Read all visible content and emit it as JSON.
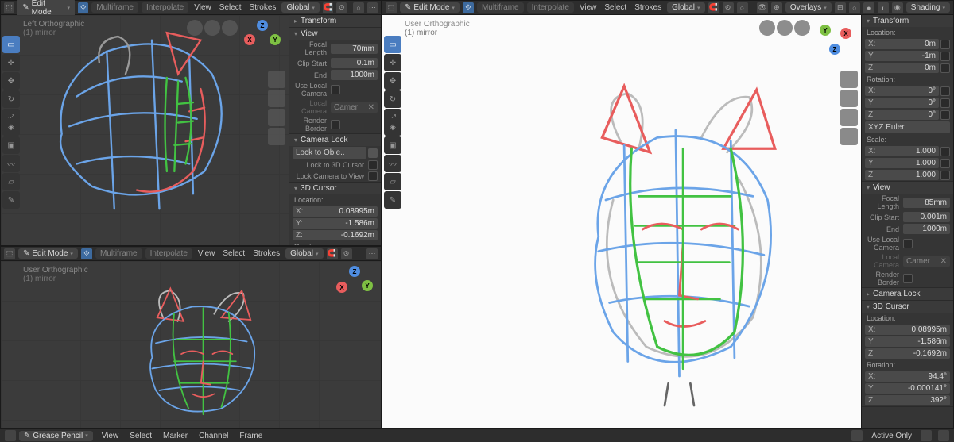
{
  "header": {
    "mode": "Edit Mode",
    "multiframe": "Multiframe",
    "interpolate": "Interpolate",
    "menus": [
      "View",
      "Select",
      "Strokes"
    ],
    "orientation": "Global",
    "overlays": "Overlays",
    "shading": "Shading"
  },
  "viewports": {
    "top_left": {
      "title": "Left Orthographic",
      "collection": "(1) mirror"
    },
    "bottom_left": {
      "title": "User Orthographic",
      "collection": "(1) mirror"
    },
    "right": {
      "title": "User Orthographic",
      "collection": "(1) mirror"
    }
  },
  "npanel": {
    "transform": "Transform",
    "view": "View",
    "focal_label": "Focal Length",
    "clip_start_label": "Clip Start",
    "end_label": "End",
    "use_local_camera": "Use Local Camera",
    "local_camera_label": "Local Camera",
    "local_camera_value": "Camer",
    "render_border": "Render Border",
    "camera_lock": "Camera Lock",
    "lock_to_object": "Lock to Obje..",
    "lock_to_3d_cursor": "Lock to 3D Cursor",
    "lock_camera_to_view": "Lock Camera to View",
    "cursor3d": "3D Cursor",
    "location": "Location:",
    "rotation": "Rotation:",
    "scale": "Scale:",
    "rot_mode": "XYZ Euler",
    "left_panel": {
      "focal": "70mm",
      "clip_start": "0.1m",
      "clip_end": "1000m",
      "cursor_x": "0.08995m",
      "cursor_y": "-1.586m",
      "cursor_z": "-0.1692m"
    },
    "right_panel": {
      "loc_x": "0m",
      "loc_y": "-1m",
      "loc_z": "0m",
      "rot_x": "0°",
      "rot_y": "0°",
      "rot_z": "0°",
      "scale_x": "1.000",
      "scale_y": "1.000",
      "scale_z": "1.000",
      "focal": "85mm",
      "clip_start": "0.001m",
      "clip_end": "1000m",
      "cursor_x": "0.08995m",
      "cursor_y": "-1.586m",
      "cursor_z": "-0.1692m",
      "cursor_rx": "94.4°",
      "cursor_ry": "-0.000141°",
      "cursor_rz": "392°"
    }
  },
  "footer": {
    "editor": "Grease Pencil",
    "menus": [
      "View",
      "Select",
      "Marker",
      "Channel",
      "Frame"
    ],
    "active_only": "Active Only"
  }
}
